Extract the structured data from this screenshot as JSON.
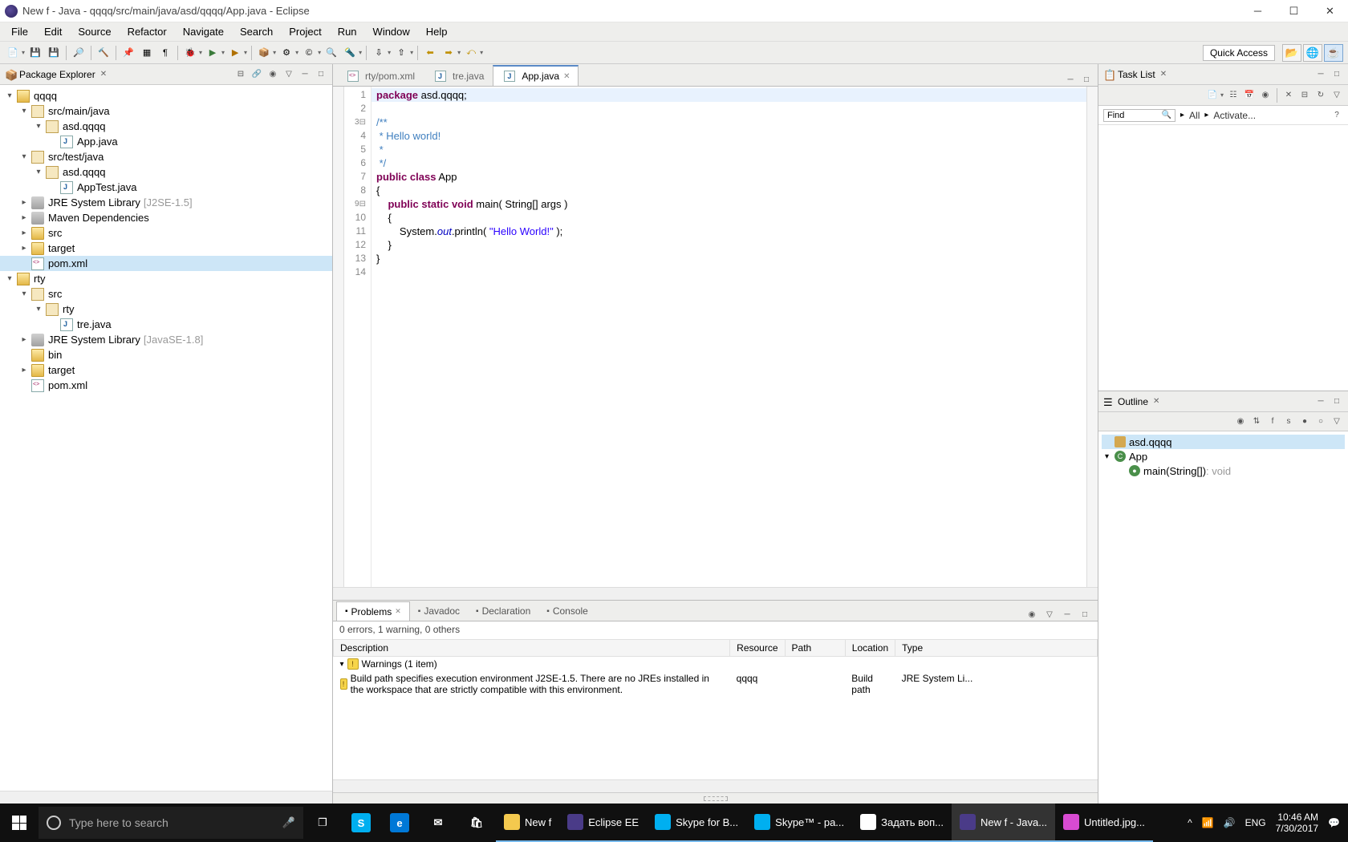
{
  "window": {
    "title": "New f - Java - qqqq/src/main/java/asd/qqqq/App.java - Eclipse"
  },
  "menu": [
    "File",
    "Edit",
    "Source",
    "Refactor",
    "Navigate",
    "Search",
    "Project",
    "Run",
    "Window",
    "Help"
  ],
  "toolbar": {
    "quick_access": "Quick Access"
  },
  "package_explorer": {
    "title": "Package Explorer",
    "tree": [
      {
        "l": "qqqq",
        "depth": 0,
        "icon": "proj",
        "expanded": true
      },
      {
        "l": "src/main/java",
        "depth": 1,
        "icon": "pkg",
        "expanded": true
      },
      {
        "l": "asd.qqqq",
        "depth": 2,
        "icon": "pkg",
        "expanded": true
      },
      {
        "l": "App.java",
        "depth": 3,
        "icon": "java",
        "leaf": true
      },
      {
        "l": "src/test/java",
        "depth": 1,
        "icon": "pkg",
        "expanded": true
      },
      {
        "l": "asd.qqqq",
        "depth": 2,
        "icon": "pkg",
        "expanded": true
      },
      {
        "l": "AppTest.java",
        "depth": 3,
        "icon": "java",
        "leaf": true
      },
      {
        "l": "JRE System Library",
        "depth": 1,
        "icon": "jar",
        "decor": "[J2SE-1.5]"
      },
      {
        "l": "Maven Dependencies",
        "depth": 1,
        "icon": "jar"
      },
      {
        "l": "src",
        "depth": 1,
        "icon": "folder"
      },
      {
        "l": "target",
        "depth": 1,
        "icon": "folder"
      },
      {
        "l": "pom.xml",
        "depth": 1,
        "icon": "xml",
        "leaf": true,
        "selected": true
      },
      {
        "l": "rty",
        "depth": 0,
        "icon": "proj",
        "expanded": true
      },
      {
        "l": "src",
        "depth": 1,
        "icon": "pkg",
        "expanded": true
      },
      {
        "l": "rty",
        "depth": 2,
        "icon": "pkg",
        "expanded": true
      },
      {
        "l": "tre.java",
        "depth": 3,
        "icon": "java",
        "leaf": true
      },
      {
        "l": "JRE System Library",
        "depth": 1,
        "icon": "jar",
        "decor": "[JavaSE-1.8]"
      },
      {
        "l": "bin",
        "depth": 1,
        "icon": "folder",
        "leaf": true
      },
      {
        "l": "target",
        "depth": 1,
        "icon": "folder"
      },
      {
        "l": "pom.xml",
        "depth": 1,
        "icon": "xml",
        "leaf": true
      }
    ]
  },
  "editor": {
    "tabs": [
      {
        "label": "rty/pom.xml",
        "icon": "xml"
      },
      {
        "label": "tre.java",
        "icon": "java"
      },
      {
        "label": "App.java",
        "icon": "java",
        "active": true
      }
    ],
    "lines": [
      {
        "n": "1",
        "html": "<span class='kw'>package</span> asd.qqqq;",
        "hl": true
      },
      {
        "n": "2",
        "html": ""
      },
      {
        "n": "3",
        "html": "<span class='cm'>/**</span>",
        "fold": true
      },
      {
        "n": "4",
        "html": "<span class='cm'> * Hello world!</span>"
      },
      {
        "n": "5",
        "html": "<span class='cm'> *</span>"
      },
      {
        "n": "6",
        "html": "<span class='cm'> */</span>"
      },
      {
        "n": "7",
        "html": "<span class='kw'>public</span> <span class='kw'>class</span> App"
      },
      {
        "n": "8",
        "html": "{"
      },
      {
        "n": "9",
        "html": "    <span class='kw'>public</span> <span class='kw'>static</span> <span class='kw'>void</span> main( String[] args )",
        "fold": true
      },
      {
        "n": "10",
        "html": "    {"
      },
      {
        "n": "11",
        "html": "        System.<span class='it'>out</span>.println( <span class='str'>\"Hello World!\"</span> );"
      },
      {
        "n": "12",
        "html": "    }"
      },
      {
        "n": "13",
        "html": "}"
      },
      {
        "n": "14",
        "html": ""
      }
    ]
  },
  "task_list": {
    "title": "Task List",
    "find": "Find",
    "all": "All",
    "activate": "Activate..."
  },
  "outline": {
    "title": "Outline",
    "items": [
      {
        "label": "asd.qqqq",
        "type": "pkg",
        "depth": 0,
        "selected": true
      },
      {
        "label": "App",
        "type": "class",
        "depth": 0,
        "expanded": true
      },
      {
        "label": "main(String[])",
        "ret": " : void",
        "type": "method",
        "depth": 1
      }
    ]
  },
  "problems": {
    "tabs": [
      {
        "label": "Problems",
        "active": true
      },
      {
        "label": "Javadoc"
      },
      {
        "label": "Declaration"
      },
      {
        "label": "Console"
      }
    ],
    "status": "0 errors, 1 warning, 0 others",
    "columns": [
      "Description",
      "Resource",
      "Path",
      "Location",
      "Type"
    ],
    "group_label": "Warnings (1 item)",
    "row": {
      "description": "Build path specifies execution environment J2SE-1.5. There are no JREs installed in the workspace that are strictly compatible with this environment.",
      "resource": "qqqq",
      "path": "",
      "location": "Build path",
      "type": "JRE System Li..."
    }
  },
  "taskbar": {
    "search_placeholder": "Type here to search",
    "apps": [
      {
        "label": "New f",
        "color": "#f4c94e",
        "running": true
      },
      {
        "label": "Eclipse EE",
        "color": "#4a3b88",
        "running": true
      },
      {
        "label": "Skype for B...",
        "color": "#00aff0",
        "running": true
      },
      {
        "label": "Skype™ - pa...",
        "color": "#00aff0",
        "running": true
      },
      {
        "label": "Задать воп...",
        "color": "#ffffff",
        "running": true
      },
      {
        "label": "New f - Java...",
        "color": "#4a3b88",
        "running": true,
        "active": true
      },
      {
        "label": "Untitled.jpg...",
        "color": "#d84bd2",
        "running": true
      }
    ],
    "lang": "ENG",
    "time": "10:46 AM",
    "date": "7/30/2017"
  }
}
